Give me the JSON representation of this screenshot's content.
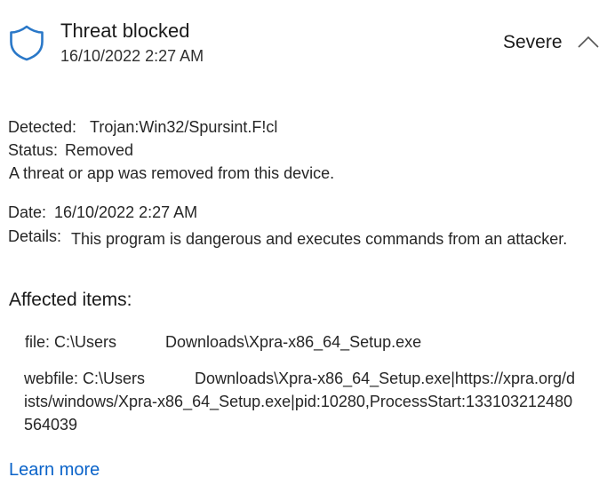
{
  "header": {
    "title": "Threat blocked",
    "timestamp": "16/10/2022 2:27 AM",
    "severity": "Severe",
    "shield_color": "#2a78c8"
  },
  "details": {
    "detected_label": "Detected:",
    "detected_value": "Trojan:Win32/Spursint.F!cl",
    "status_label": "Status:",
    "status_value": "Removed",
    "note": "A threat or app was removed from this device.",
    "date_label": "Date:",
    "date_value": "16/10/2022 2:27 AM",
    "details_label": "Details:",
    "details_value": "This program is dangerous and executes commands from an attacker."
  },
  "affected": {
    "heading": "Affected items:",
    "items": [
      {
        "prefix": "file: C:\\Users",
        "suffix": "Downloads\\Xpra-x86_64_Setup.exe"
      },
      {
        "prefix": "webfile: C:\\Users",
        "suffix": "Downloads\\Xpra-x86_64_Setup.exe|https://xpra.org/dists/windows/Xpra-x86_64_Setup.exe|pid:10280,ProcessStart:133103212480564039"
      }
    ]
  },
  "footer": {
    "learn_more": "Learn more",
    "link_color": "#0a63c9"
  }
}
